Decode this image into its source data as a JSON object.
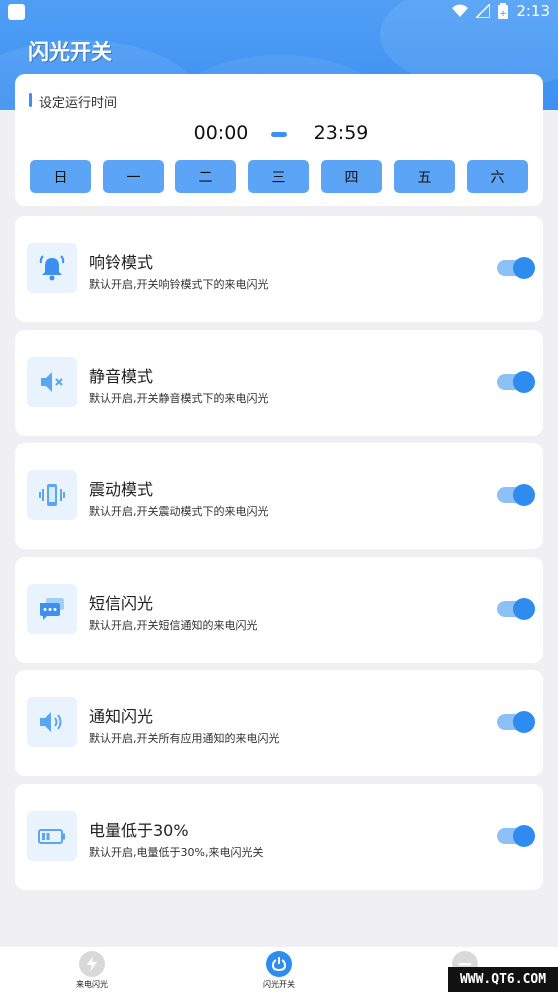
{
  "status_bar": {
    "time": "2:13"
  },
  "page": {
    "title": "闪光开关"
  },
  "schedule": {
    "label": "设定运行时间",
    "start_time": "00:00",
    "end_time": "23:59",
    "days": [
      "日",
      "一",
      "二",
      "三",
      "四",
      "五",
      "六"
    ]
  },
  "modes": [
    {
      "title": "响铃模式",
      "desc": "默认开启,开关响铃模式下的来电闪光",
      "icon": "bell-icon",
      "enabled": true
    },
    {
      "title": "静音模式",
      "desc": "默认开启,开关静音模式下的来电闪光",
      "icon": "mute-icon",
      "enabled": true
    },
    {
      "title": "震动模式",
      "desc": "默认开启,开关震动模式下的来电闪光",
      "icon": "vibrate-icon",
      "enabled": true
    },
    {
      "title": "短信闪光",
      "desc": "默认开启,开关短信通知的来电闪光",
      "icon": "message-icon",
      "enabled": true
    },
    {
      "title": "通知闪光",
      "desc": "默认开启,开关所有应用通知的来电闪光",
      "icon": "speaker-icon",
      "enabled": true
    },
    {
      "title": "电量低于30%",
      "desc": "默认开启,电量低于30%,来电闪光关",
      "icon": "battery-icon",
      "enabled": true
    }
  ],
  "bottom_nav": [
    {
      "label": "来电闪光",
      "icon": "flash-icon",
      "active": false
    },
    {
      "label": "闪光开关",
      "icon": "power-icon",
      "active": true
    }
  ],
  "watermark": "WWW.QT6.COM",
  "colors": {
    "accent": "#3d8ff1",
    "day_button": "#5ca4f6",
    "toggle_track": "#8cc0f7",
    "toggle_knob": "#2e8bf0"
  }
}
